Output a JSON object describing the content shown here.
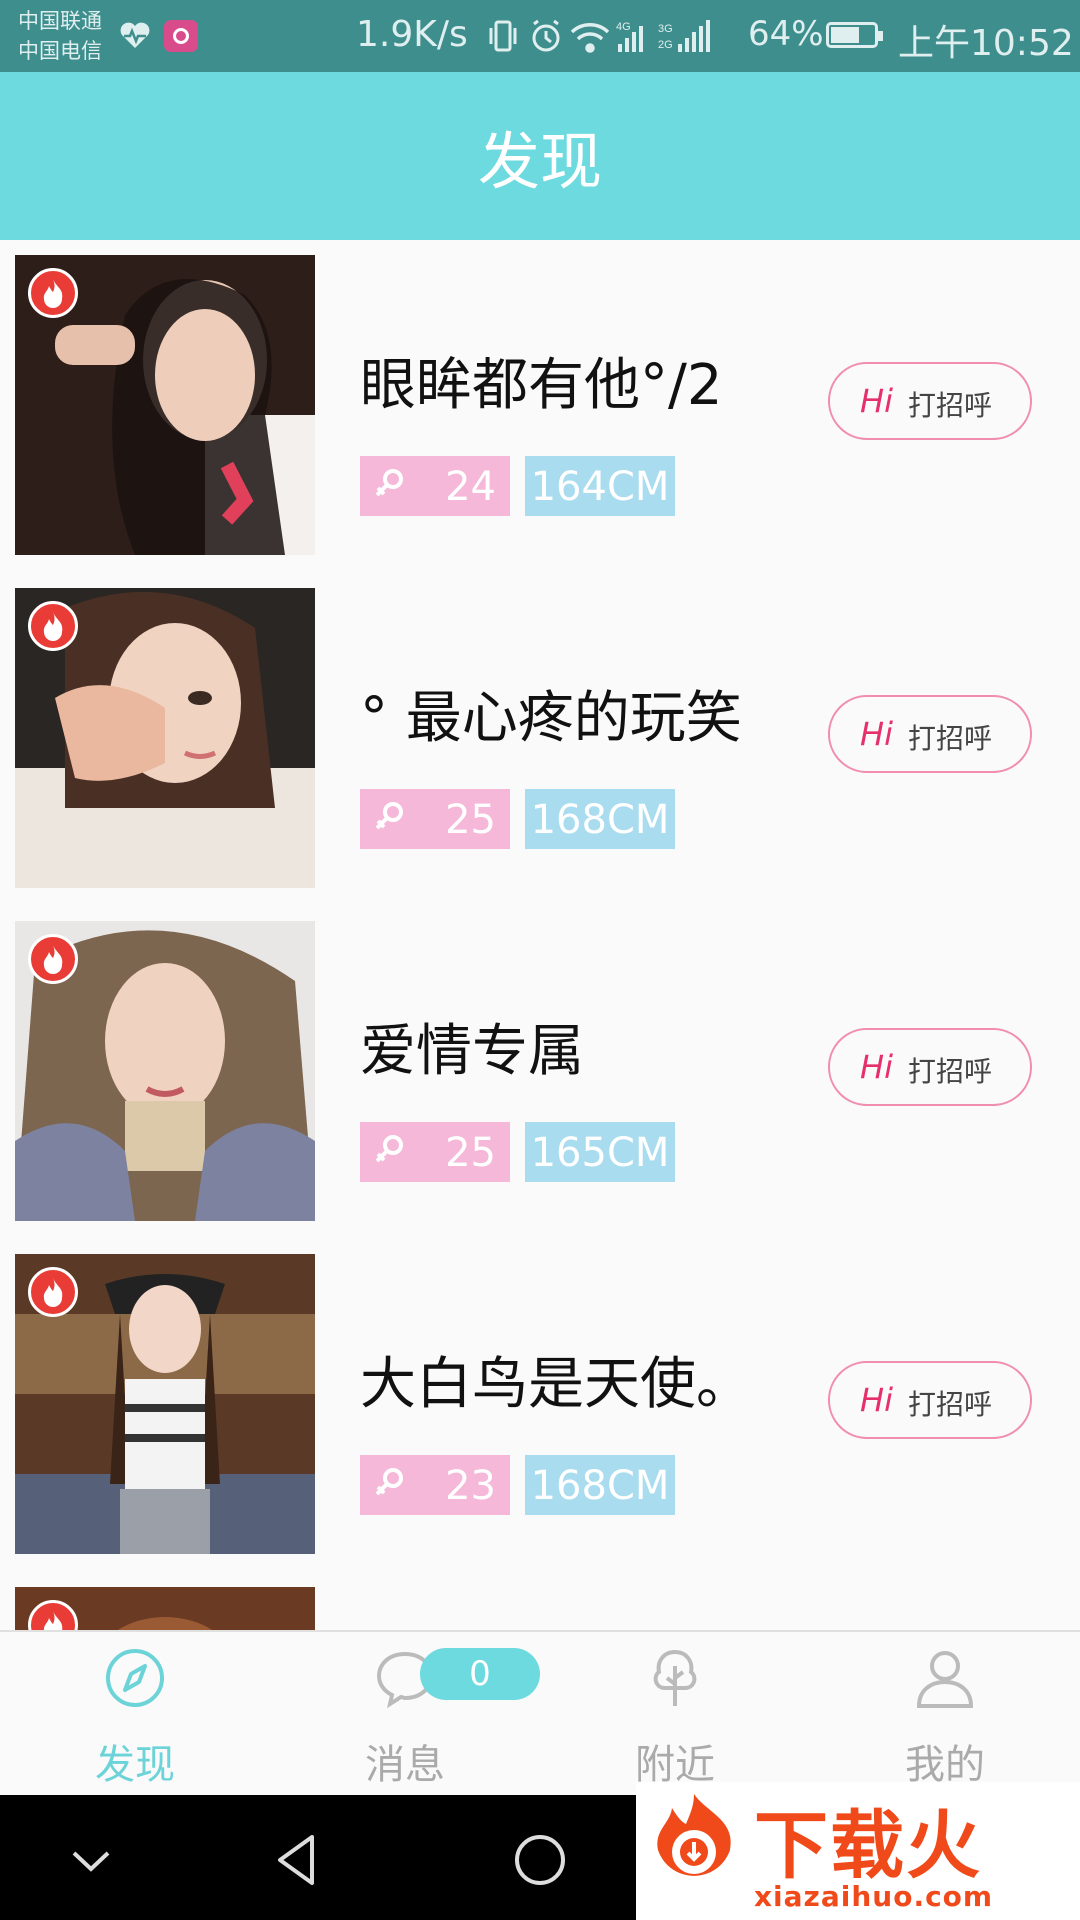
{
  "status_bar": {
    "carrier_1": "中国联通",
    "carrier_2": "中国电信",
    "net_speed": "1.9K/s",
    "network_4g": "4G",
    "network_3g": "3G",
    "network_2g": "2G",
    "battery": "64%",
    "time": "上午10:52"
  },
  "header": {
    "title": "发现"
  },
  "users": [
    {
      "name": "眼眸都有他°/2",
      "age": "24",
      "height": "164CM",
      "hi": "Hi",
      "greet": "打招呼"
    },
    {
      "name": "° 最心疼的玩笑",
      "age": "25",
      "height": "168CM",
      "hi": "Hi",
      "greet": "打招呼"
    },
    {
      "name": "爱情专属",
      "age": "25",
      "height": "165CM",
      "hi": "Hi",
      "greet": "打招呼"
    },
    {
      "name": "大白鸟是天使。",
      "age": "23",
      "height": "168CM",
      "hi": "Hi",
      "greet": "打招呼"
    }
  ],
  "bottom_nav": {
    "discover": "发现",
    "messages": "消息",
    "messages_badge": "0",
    "nearby": "附近",
    "mine": "我的"
  },
  "watermark": {
    "title": "下载火",
    "sub": "xiazaihuo.com"
  },
  "colors": {
    "accent": "#6cdadf",
    "hot": "#e93c36",
    "age_tag": "#f5b8d8",
    "height_tag": "#a9dcef"
  }
}
